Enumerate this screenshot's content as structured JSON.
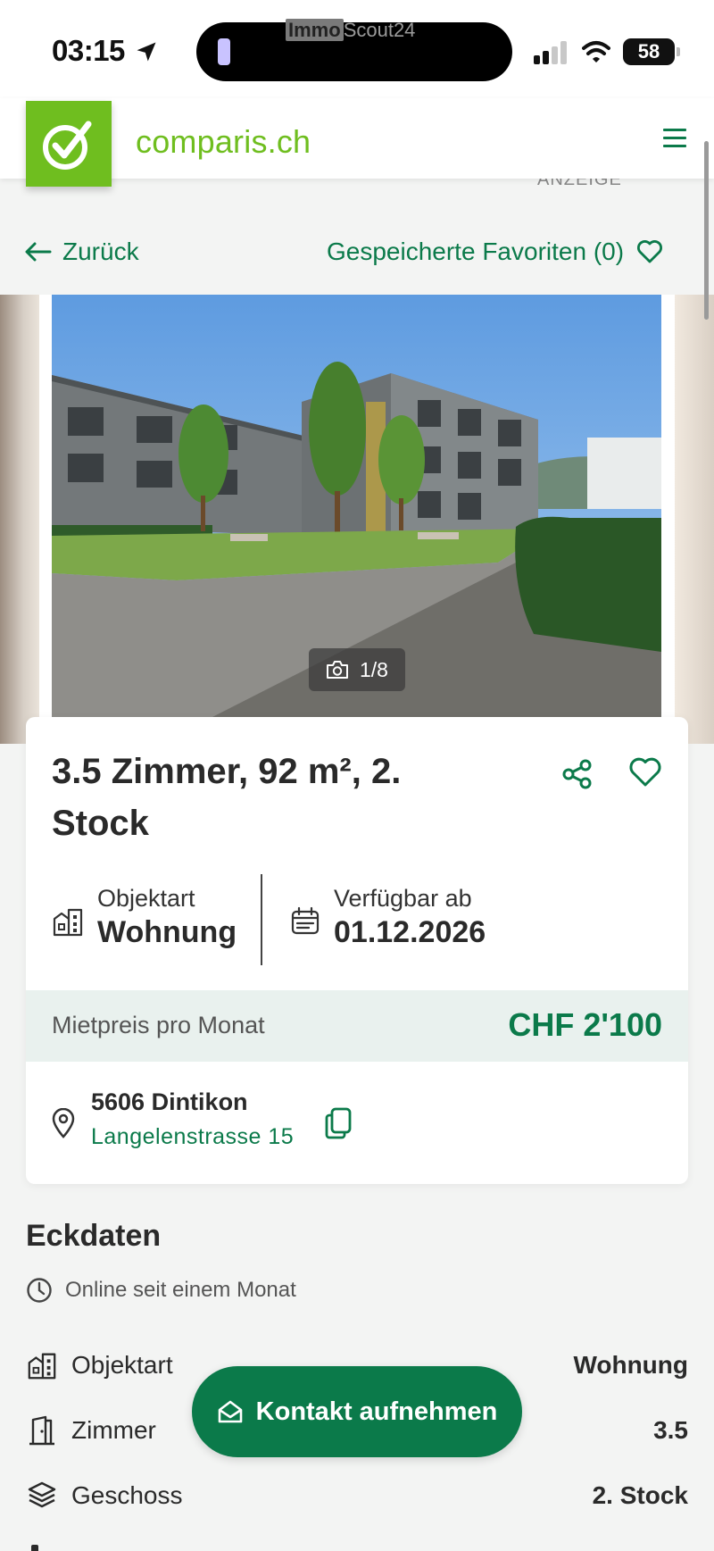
{
  "status_bar": {
    "time": "03:15",
    "island_text_brand": "Immo",
    "island_text": "Scout24",
    "battery": "58"
  },
  "header": {
    "logo_text": "comparis.ch",
    "ad_label": "ANZEIGE"
  },
  "nav": {
    "back_label": "Zurück",
    "favorites_label": "Gespeicherte Favoriten (0)"
  },
  "gallery": {
    "counter": "1/8"
  },
  "listing": {
    "title": "3.5 Zimmer, 92 m², 2. Stock",
    "object_type_label": "Objektart",
    "object_type_value": "Wohnung",
    "available_label": "Verfügbar ab",
    "available_value": "01.12.2026",
    "price_label": "Mietpreis pro Monat",
    "price_value": "CHF 2'100",
    "address_city": "5606 Dintikon",
    "address_street": "Langelenstrasse 15"
  },
  "key_data": {
    "title": "Eckdaten",
    "online_since": "Online seit einem Monat",
    "rows": [
      {
        "label": "Objektart",
        "value": "Wohnung",
        "icon": "building-icon"
      },
      {
        "label": "Zimmer",
        "value": "3.5",
        "icon": "door-icon"
      },
      {
        "label": "Geschoss",
        "value": "2. Stock",
        "icon": "layers-icon"
      }
    ]
  },
  "cta": {
    "label": "Kontakt aufnehmen"
  },
  "colors": {
    "brand_green": "#6fbe1f",
    "accent_green": "#0b7a4a",
    "price_bg": "#e9f1ee"
  }
}
